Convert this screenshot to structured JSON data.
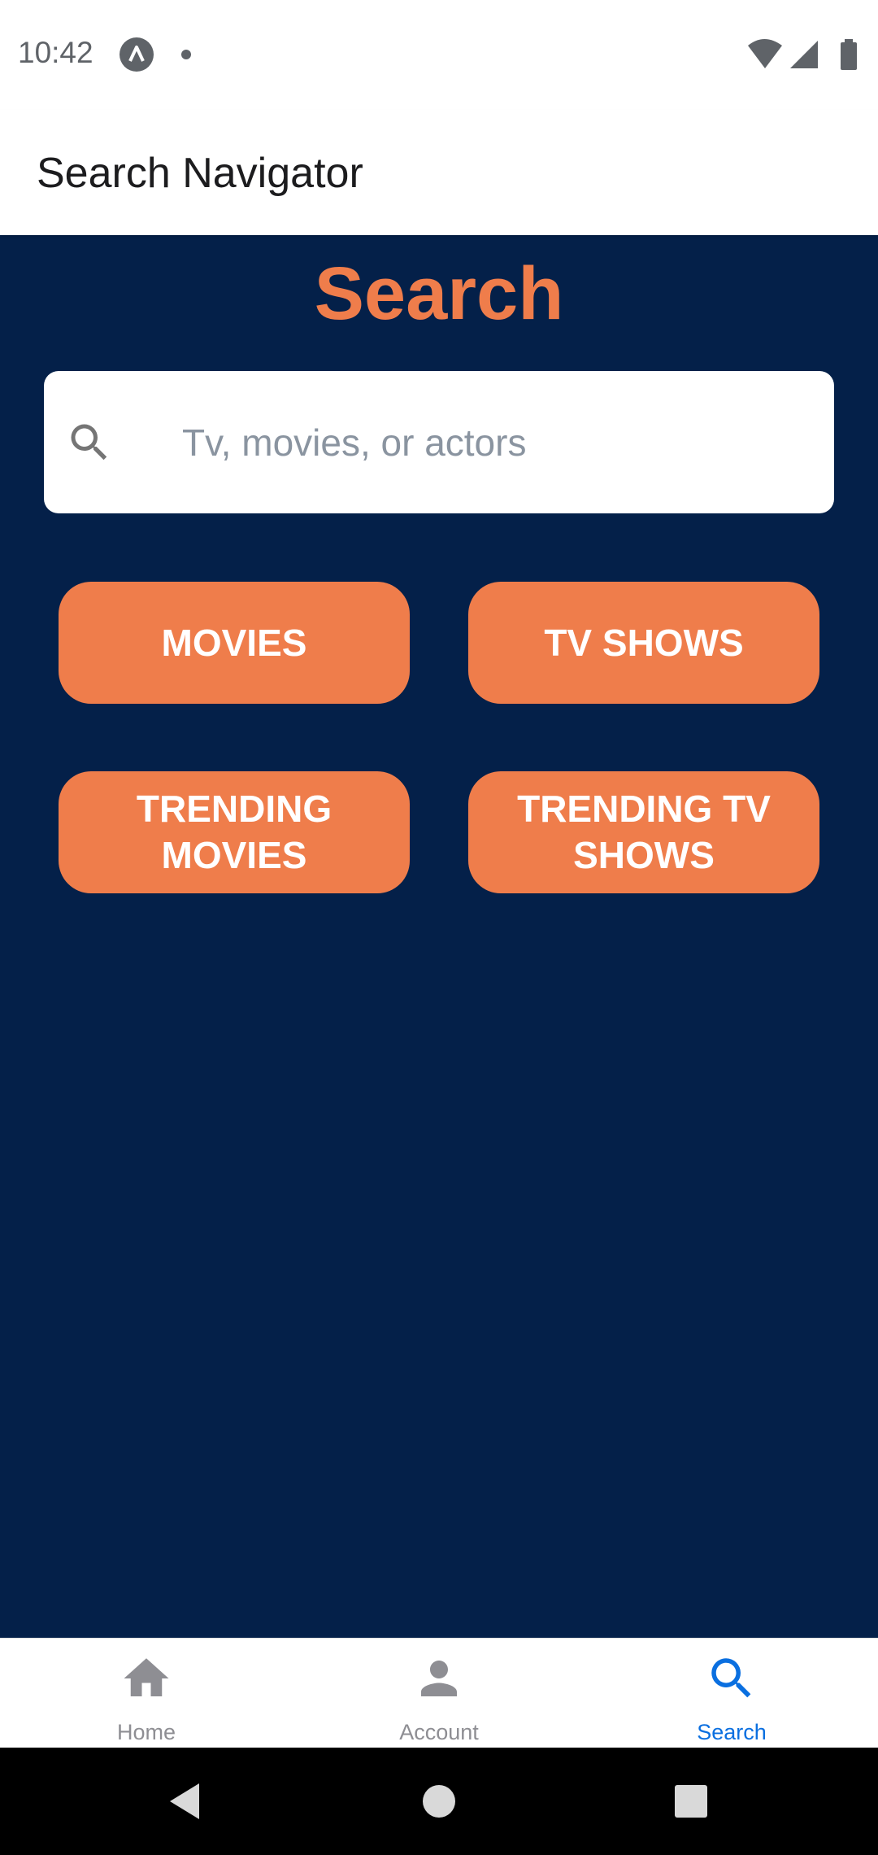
{
  "status_bar": {
    "time": "10:42"
  },
  "header": {
    "title": "Search Navigator"
  },
  "main": {
    "heading": "Search",
    "search": {
      "placeholder": "Tv, movies, or actors",
      "value": ""
    },
    "buttons": [
      {
        "label": "MOVIES"
      },
      {
        "label": "TV SHOWS"
      },
      {
        "label": "TRENDING MOVIES"
      },
      {
        "label": "TRENDING TV SHOWS"
      }
    ]
  },
  "tab_bar": {
    "tabs": [
      {
        "label": "Home",
        "icon": "home-icon"
      },
      {
        "label": "Account",
        "icon": "account-icon"
      },
      {
        "label": "Search",
        "icon": "search-icon",
        "active": true
      }
    ]
  },
  "colors": {
    "background": "#042049",
    "accent": "#ef7d4b",
    "active_tab": "#0a6fe0",
    "inactive_tab": "#8e8e93"
  }
}
